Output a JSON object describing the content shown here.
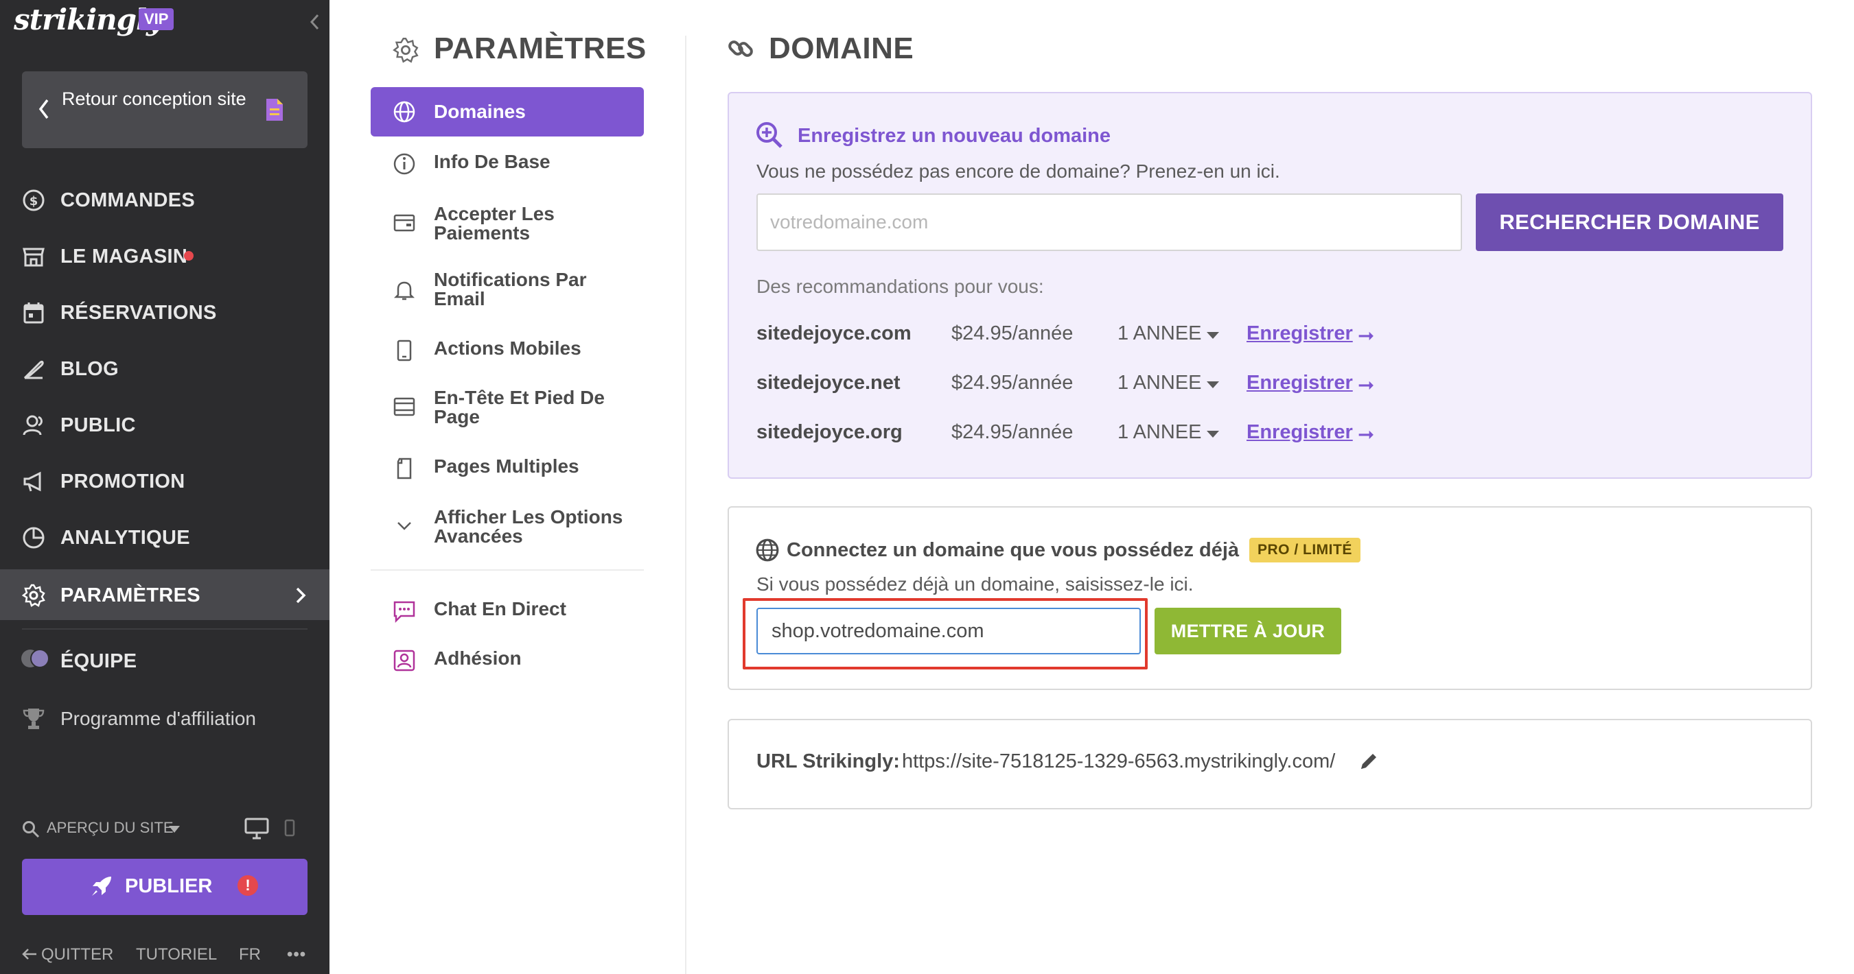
{
  "sidebar": {
    "logo": "strikingly",
    "badge": "VIP",
    "back_label": "Retour conception site",
    "nav": [
      {
        "label": "COMMANDES",
        "icon": "dollar-circle-icon"
      },
      {
        "label": "LE MAGASIN",
        "icon": "store-icon",
        "dot": true
      },
      {
        "label": "RÉSERVATIONS",
        "icon": "calendar-icon"
      },
      {
        "label": "BLOG",
        "icon": "feather-icon"
      },
      {
        "label": "PUBLIC",
        "icon": "users-icon"
      },
      {
        "label": "PROMOTION",
        "icon": "megaphone-icon"
      },
      {
        "label": "ANALYTIQUE",
        "icon": "pie-chart-icon"
      },
      {
        "label": "PARAMÈTRES",
        "icon": "gear-icon",
        "active": true
      }
    ],
    "team_label": "ÉQUIPE",
    "affiliate_label": "Programme d'affiliation",
    "preview_label": "APERÇU DU SITE",
    "publish_label": "PUBLIER",
    "publish_warning": "!",
    "footer": {
      "quit": "QUITTER",
      "tutorial": "TUTORIEL",
      "lang": "FR",
      "more": "•••"
    }
  },
  "settings": {
    "title": "PARAMÈTRES",
    "menu": [
      {
        "label": "Domaines",
        "icon": "globe-icon",
        "active": true
      },
      {
        "label": "Info De Base",
        "icon": "info-icon"
      },
      {
        "label": "Accepter Les Paiements",
        "icon": "payment-card-icon"
      },
      {
        "label": "Notifications Par Email",
        "icon": "bell-icon"
      },
      {
        "label": "Actions Mobiles",
        "icon": "mobile-icon"
      },
      {
        "label": "En-Tête Et Pied De Page",
        "icon": "layout-icon"
      },
      {
        "label": "Pages Multiples",
        "icon": "pages-icon"
      },
      {
        "label": "Afficher Les Options Avancées",
        "icon": "chevron-down-icon"
      },
      {
        "label": "Chat En Direct",
        "icon": "chat-icon"
      },
      {
        "label": "Adhésion",
        "icon": "member-icon"
      }
    ]
  },
  "domain": {
    "title": "DOMAINE",
    "register": {
      "title": "Enregistrez un nouveau domaine",
      "subtitle": "Vous ne possédez pas encore de domaine? Prenez-en un ici.",
      "placeholder": "votredomaine.com",
      "search_button": "RECHERCHER DOMAINE",
      "reco_label": "Des recommandations pour vous:",
      "recommendations": [
        {
          "domain": "sitedejoyce.com",
          "price": "$24.95/année",
          "period": "1 ANNEE",
          "action": "Enregistrer"
        },
        {
          "domain": "sitedejoyce.net",
          "price": "$24.95/année",
          "period": "1 ANNEE",
          "action": "Enregistrer"
        },
        {
          "domain": "sitedejoyce.org",
          "price": "$24.95/année",
          "period": "1 ANNEE",
          "action": "Enregistrer"
        }
      ]
    },
    "connect": {
      "title": "Connectez un domaine que vous possédez déjà",
      "badge": "PRO / LIMITÉ",
      "subtitle": "Si vous possédez déjà un domaine, saisissez-le ici.",
      "value": "shop.votredomaine.com",
      "update_button": "METTRE À JOUR"
    },
    "url": {
      "label": "URL Strikingly:",
      "value": "https://site-7518125-1329-6563.mystrikingly.com/"
    }
  },
  "colors": {
    "sidebar_bg": "#2c2c2e",
    "accent_purple": "#7e56d1",
    "update_green": "#8fb835",
    "highlight_red": "#e13a2d",
    "badge_yellow": "#f2d25c"
  }
}
